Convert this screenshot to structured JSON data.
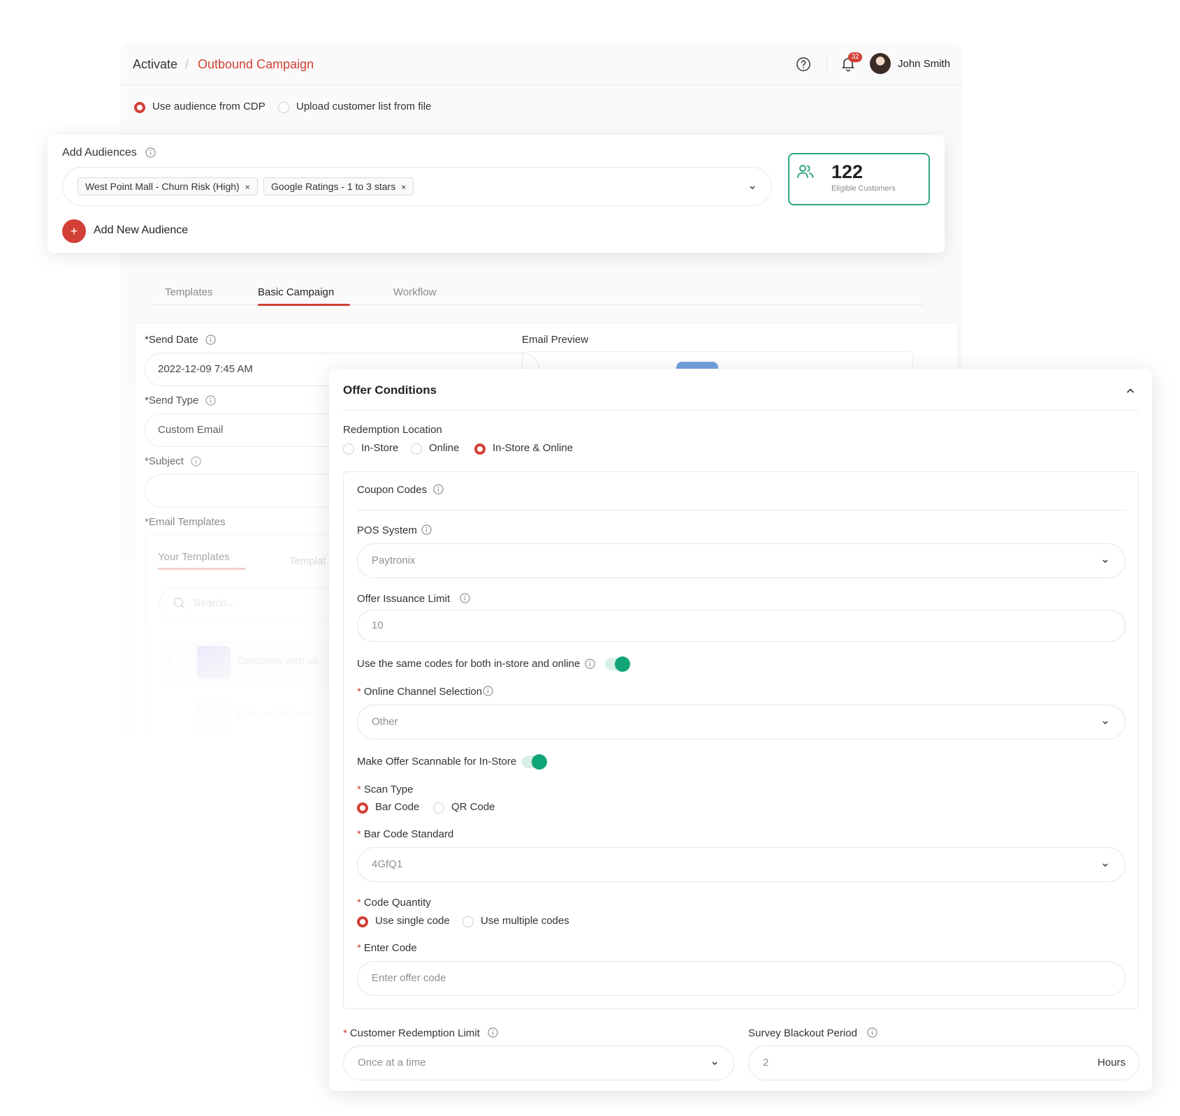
{
  "header": {
    "breadcrumb_root": "Activate",
    "breadcrumb_sep": "/",
    "breadcrumb_current": "Outbound Campaign",
    "notifications_count": "32",
    "user_name": "John Smith"
  },
  "audience_source": {
    "option_cdp": "Use audience from CDP",
    "option_upload": "Upload customer list from file"
  },
  "audiences": {
    "label": "Add Audiences",
    "chips": [
      "West Point Mall - Churn Risk (High)",
      "Google Ratings - 1 to 3 stars"
    ],
    "chip_remove": "×",
    "add_new_icon": "+",
    "add_new_label": "Add New Audience",
    "eligible_count": "122",
    "eligible_label": "Eligible Customers"
  },
  "tabs": {
    "templates": "Templates",
    "basic": "Basic Campaign",
    "workflow": "Workflow"
  },
  "campaign_form": {
    "send_date_label": "*Send Date",
    "send_date_value": "2022-12-09 7:45 AM",
    "send_type_label": "*Send Type",
    "send_type_value": "Custom Email",
    "subject_label": "*Subject",
    "email_templates_label": "*Email Templates",
    "email_preview_label": "Email Preview",
    "your_templates_tab": "Your Templates",
    "templates_tab_partial": "Templat",
    "search_placeholder": "Search...",
    "template_items": [
      "Celebrate with us",
      "Dine-in discount"
    ]
  },
  "offer": {
    "title": "Offer Conditions",
    "redemption_location_label": "Redemption Location",
    "loc_instore": "In-Store",
    "loc_online": "Online",
    "loc_both": "In-Store & Online",
    "coupon_codes_label": "Coupon Codes",
    "pos_label": "POS System",
    "pos_value": "Paytronix",
    "issuance_label": "Offer Issuance Limit",
    "issuance_value": "10",
    "same_codes_label": "Use the same codes for both in-store and online",
    "channel_label": "Online Channel Selection",
    "channel_value": "Other",
    "scannable_label": "Make Offer Scannable for In-Store",
    "scan_type_label": "Scan Type",
    "scan_bar": "Bar Code",
    "scan_qr": "QR Code",
    "bar_standard_label": "Bar Code Standard",
    "bar_standard_value": "4GfQ1",
    "code_qty_label": "Code Quantity",
    "qty_single": "Use single code",
    "qty_multiple": "Use multiple codes",
    "enter_code_label": "Enter Code",
    "enter_code_placeholder": "Enter offer code",
    "redemption_limit_label": "Customer Redemption Limit",
    "redemption_limit_value": "Once at a time",
    "blackout_label": "Survey Blackout Period",
    "blackout_value": "2",
    "blackout_unit": "Hours",
    "required_mark": "*"
  },
  "colors": {
    "accent": "#d23f36",
    "success": "#12a578",
    "border": "#e5e5e5"
  }
}
